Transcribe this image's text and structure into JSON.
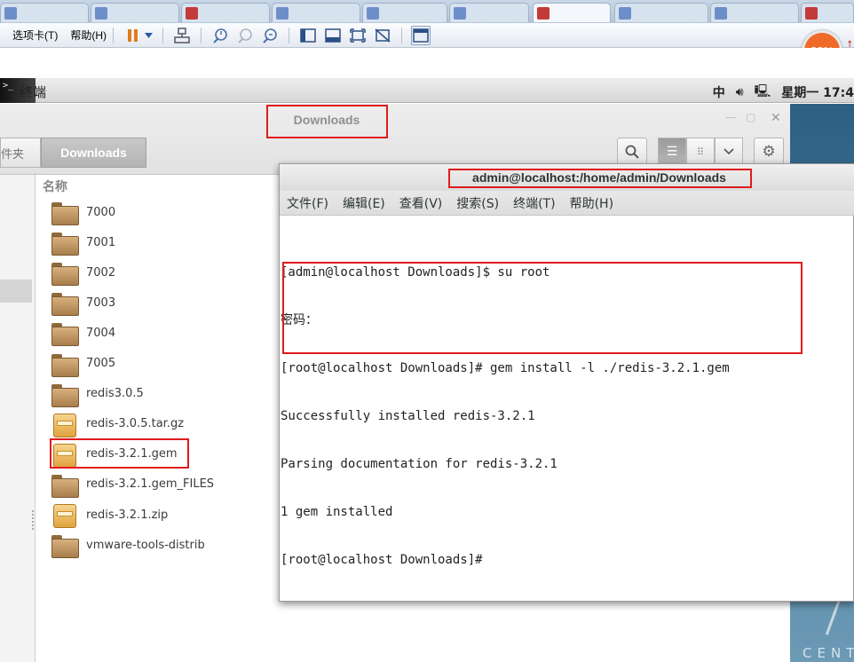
{
  "vm": {
    "menu_tabs_label": "选项卡(T)",
    "menu_help_label": "帮助(H)",
    "cpu_percent": "82%"
  },
  "gnome": {
    "app_menu": "终端",
    "input_method": "中",
    "clock": "星期一 17:4"
  },
  "files": {
    "window_title": "Downloads",
    "path_prev": "件夹",
    "path_current": "Downloads",
    "column_name": "名称",
    "items": [
      {
        "name": "7000",
        "kind": "folder"
      },
      {
        "name": "7001",
        "kind": "folder"
      },
      {
        "name": "7002",
        "kind": "folder"
      },
      {
        "name": "7003",
        "kind": "folder"
      },
      {
        "name": "7004",
        "kind": "folder"
      },
      {
        "name": "7005",
        "kind": "folder"
      },
      {
        "name": "redis3.0.5",
        "kind": "folder"
      },
      {
        "name": "redis-3.0.5.tar.gz",
        "kind": "archive"
      },
      {
        "name": "redis-3.2.1.gem",
        "kind": "archive"
      },
      {
        "name": "redis-3.2.1.gem_FILES",
        "kind": "folder"
      },
      {
        "name": "redis-3.2.1.zip",
        "kind": "archive"
      },
      {
        "name": "vmware-tools-distrib",
        "kind": "folder"
      }
    ]
  },
  "terminal": {
    "title": "admin@localhost:/home/admin/Downloads",
    "menus": [
      "文件(F)",
      "编辑(E)",
      "查看(V)",
      "搜索(S)",
      "终端(T)",
      "帮助(H)"
    ],
    "lines": [
      "[admin@localhost Downloads]$ su root",
      "密码：",
      "[root@localhost Downloads]# gem install -l ./redis-3.2.1.gem",
      "Successfully installed redis-3.2.1",
      "Parsing documentation for redis-3.2.1",
      "1 gem installed",
      "[root@localhost Downloads]#"
    ]
  },
  "desktop": {
    "brand_text": "CENT"
  }
}
